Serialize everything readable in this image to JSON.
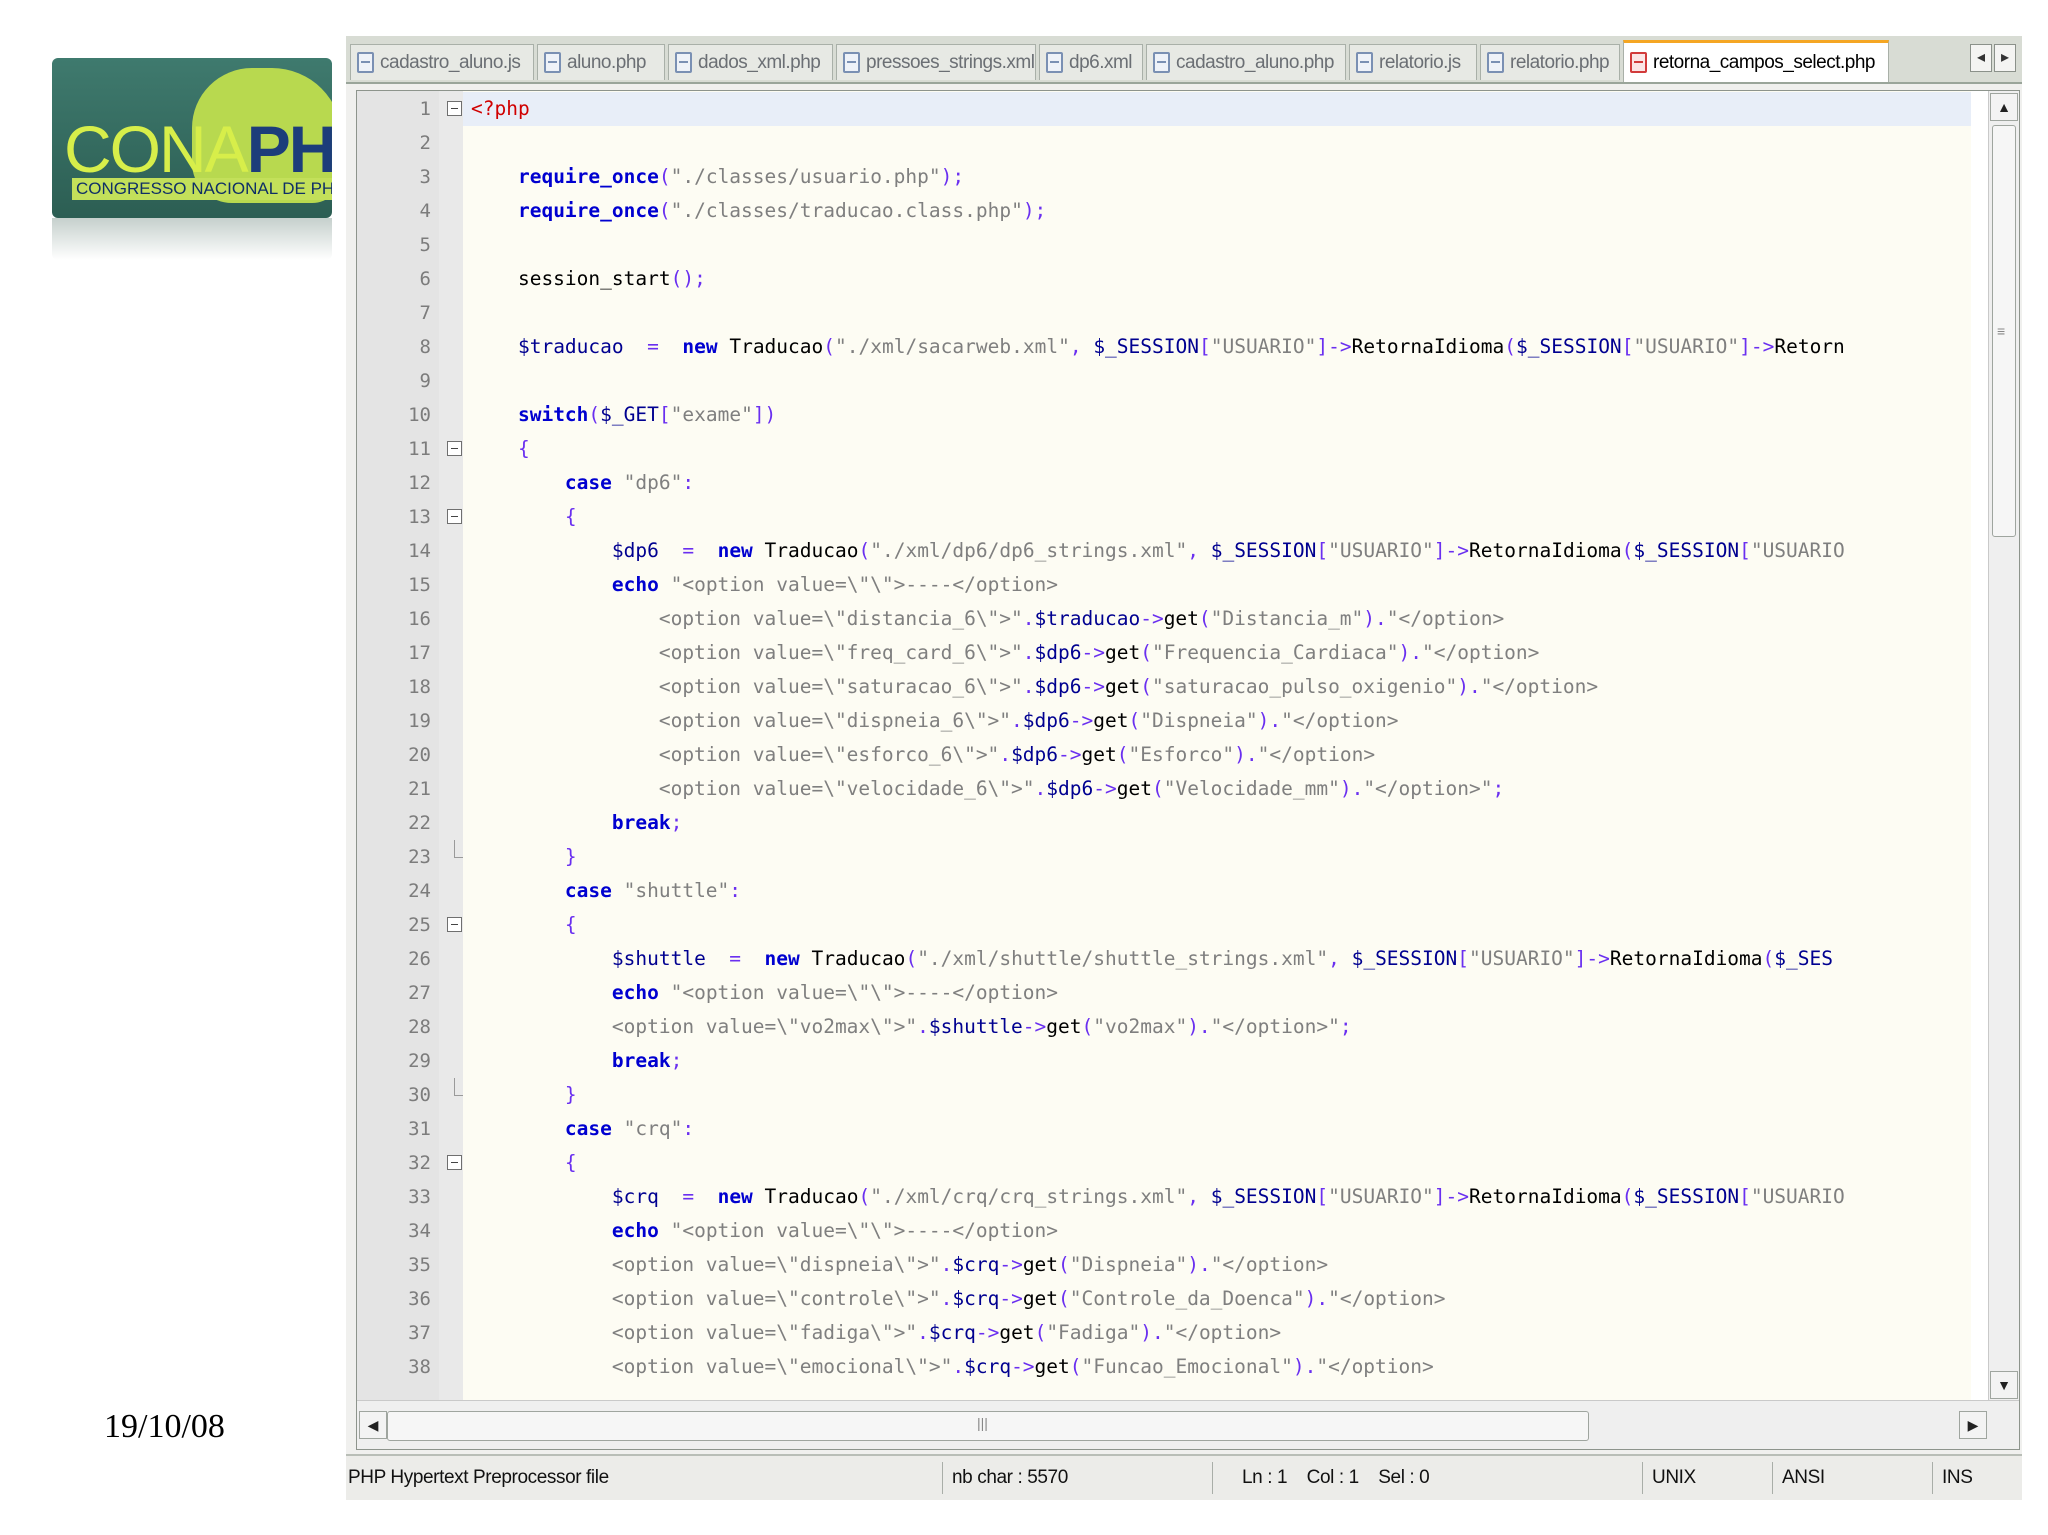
{
  "logo": {
    "main_left": "CONA",
    "main_right": "PHP",
    "sub": "CONGRESSO NACIONAL DE PHP"
  },
  "slide_date": "19/10/08",
  "tabs": [
    {
      "label": "cadastro_aluno.js",
      "active": false
    },
    {
      "label": "aluno.php",
      "active": false
    },
    {
      "label": "dados_xml.php",
      "active": false
    },
    {
      "label": "pressoes_strings.xml",
      "active": false
    },
    {
      "label": "dp6.xml",
      "active": false
    },
    {
      "label": "cadastro_aluno.php",
      "active": false
    },
    {
      "label": "relatorio.js",
      "active": false
    },
    {
      "label": "relatorio.php",
      "active": false
    },
    {
      "label": "retorna_campos_select.php",
      "active": true
    }
  ],
  "tab_nav": {
    "left": "◂",
    "right": "▸"
  },
  "scroll_glyphs": {
    "up": "▲",
    "down": "▼",
    "left": "◀",
    "right": "▶",
    "vgrip": "≡",
    "hgrip": "|||"
  },
  "lines": [
    {
      "n": "1",
      "fold": "open",
      "tokens": [
        [
          "php",
          "<?php"
        ]
      ]
    },
    {
      "n": "2",
      "tokens": []
    },
    {
      "n": "3",
      "tokens": [
        [
          "",
          "    "
        ],
        [
          "kw",
          "require_once"
        ],
        [
          "op",
          "("
        ],
        [
          "str",
          "\"./classes/usuario.php\""
        ],
        [
          "op",
          ");"
        ]
      ]
    },
    {
      "n": "4",
      "tokens": [
        [
          "",
          "    "
        ],
        [
          "kw",
          "require_once"
        ],
        [
          "op",
          "("
        ],
        [
          "str",
          "\"./classes/traducao.class.php\""
        ],
        [
          "op",
          ");"
        ]
      ]
    },
    {
      "n": "5",
      "tokens": []
    },
    {
      "n": "6",
      "tokens": [
        [
          "",
          "    session_start"
        ],
        [
          "op",
          "();"
        ]
      ]
    },
    {
      "n": "7",
      "tokens": []
    },
    {
      "n": "8",
      "tokens": [
        [
          "",
          "    "
        ],
        [
          "var",
          "$traducao"
        ],
        [
          "",
          "  "
        ],
        [
          "op",
          "="
        ],
        [
          "",
          "  "
        ],
        [
          "kw",
          "new"
        ],
        [
          "",
          " Traducao"
        ],
        [
          "op",
          "("
        ],
        [
          "str",
          "\"./xml/sacarweb.xml\""
        ],
        [
          "op",
          ","
        ],
        [
          "",
          ""
        ],
        [
          "var",
          " $_SESSION"
        ],
        [
          "op",
          "["
        ],
        [
          "str",
          "\"USUARIO\""
        ],
        [
          "op",
          "]->"
        ],
        [
          "",
          "RetornaIdioma"
        ],
        [
          "op",
          "("
        ],
        [
          "var",
          "$_SESSION"
        ],
        [
          "op",
          "["
        ],
        [
          "str",
          "\"USUARIO\""
        ],
        [
          "op",
          "]->"
        ],
        [
          "",
          "Retorn"
        ]
      ]
    },
    {
      "n": "9",
      "tokens": []
    },
    {
      "n": "10",
      "tokens": [
        [
          "",
          "    "
        ],
        [
          "kw",
          "switch"
        ],
        [
          "op",
          "("
        ],
        [
          "var",
          "$_GET"
        ],
        [
          "op",
          "["
        ],
        [
          "str",
          "\"exame\""
        ],
        [
          "op",
          "])"
        ]
      ]
    },
    {
      "n": "11",
      "fold": "open",
      "tokens": [
        [
          "",
          "    "
        ],
        [
          "op",
          "{"
        ]
      ]
    },
    {
      "n": "12",
      "tokens": [
        [
          "",
          "        "
        ],
        [
          "kw",
          "case"
        ],
        [
          "str",
          " \"dp6\""
        ],
        [
          "op",
          ":"
        ]
      ]
    },
    {
      "n": "13",
      "fold": "open",
      "tokens": [
        [
          "",
          "        "
        ],
        [
          "op",
          "{"
        ]
      ]
    },
    {
      "n": "14",
      "tokens": [
        [
          "",
          "            "
        ],
        [
          "var",
          "$dp6"
        ],
        [
          "",
          "  "
        ],
        [
          "op",
          "="
        ],
        [
          "",
          "  "
        ],
        [
          "kw",
          "new"
        ],
        [
          "",
          " Traducao"
        ],
        [
          "op",
          "("
        ],
        [
          "str",
          "\"./xml/dp6/dp6_strings.xml\""
        ],
        [
          "op",
          ","
        ],
        [
          "var",
          " $_SESSION"
        ],
        [
          "op",
          "["
        ],
        [
          "str",
          "\"USUARIO\""
        ],
        [
          "op",
          "]->"
        ],
        [
          "",
          "RetornaIdioma"
        ],
        [
          "op",
          "("
        ],
        [
          "var",
          "$_SESSION"
        ],
        [
          "op",
          "["
        ],
        [
          "str",
          "\"USUARIO"
        ]
      ]
    },
    {
      "n": "15",
      "tokens": [
        [
          "",
          "            "
        ],
        [
          "kw",
          "echo"
        ],
        [
          "str",
          " \"<option value=\\\"\\\">----</option>"
        ]
      ]
    },
    {
      "n": "16",
      "tokens": [
        [
          "str",
          "                <option value=\\\"distancia_6\\\">\""
        ],
        [
          "op",
          "."
        ],
        [
          "var",
          "$traducao"
        ],
        [
          "op",
          "->"
        ],
        [
          "",
          "get"
        ],
        [
          "op",
          "("
        ],
        [
          "str",
          "\"Distancia_m\""
        ],
        [
          "op",
          ")."
        ],
        [
          "str",
          "\"</option>"
        ]
      ]
    },
    {
      "n": "17",
      "tokens": [
        [
          "str",
          "                <option value=\\\"freq_card_6\\\">\""
        ],
        [
          "op",
          "."
        ],
        [
          "var",
          "$dp6"
        ],
        [
          "op",
          "->"
        ],
        [
          "",
          "get"
        ],
        [
          "op",
          "("
        ],
        [
          "str",
          "\"Frequencia_Cardiaca\""
        ],
        [
          "op",
          ")."
        ],
        [
          "str",
          "\"</option>"
        ]
      ]
    },
    {
      "n": "18",
      "tokens": [
        [
          "str",
          "                <option value=\\\"saturacao_6\\\">\""
        ],
        [
          "op",
          "."
        ],
        [
          "var",
          "$dp6"
        ],
        [
          "op",
          "->"
        ],
        [
          "",
          "get"
        ],
        [
          "op",
          "("
        ],
        [
          "str",
          "\"saturacao_pulso_oxigenio\""
        ],
        [
          "op",
          ")."
        ],
        [
          "str",
          "\"</option>"
        ]
      ]
    },
    {
      "n": "19",
      "tokens": [
        [
          "str",
          "                <option value=\\\"dispneia_6\\\">\""
        ],
        [
          "op",
          "."
        ],
        [
          "var",
          "$dp6"
        ],
        [
          "op",
          "->"
        ],
        [
          "",
          "get"
        ],
        [
          "op",
          "("
        ],
        [
          "str",
          "\"Dispneia\""
        ],
        [
          "op",
          ")."
        ],
        [
          "str",
          "\"</option>"
        ]
      ]
    },
    {
      "n": "20",
      "tokens": [
        [
          "str",
          "                <option value=\\\"esforco_6\\\">\""
        ],
        [
          "op",
          "."
        ],
        [
          "var",
          "$dp6"
        ],
        [
          "op",
          "->"
        ],
        [
          "",
          "get"
        ],
        [
          "op",
          "("
        ],
        [
          "str",
          "\"Esforco\""
        ],
        [
          "op",
          ")."
        ],
        [
          "str",
          "\"</option>"
        ]
      ]
    },
    {
      "n": "21",
      "tokens": [
        [
          "str",
          "                <option value=\\\"velocidade_6\\\">\""
        ],
        [
          "op",
          "."
        ],
        [
          "var",
          "$dp6"
        ],
        [
          "op",
          "->"
        ],
        [
          "",
          "get"
        ],
        [
          "op",
          "("
        ],
        [
          "str",
          "\"Velocidade_mm\""
        ],
        [
          "op",
          ")."
        ],
        [
          "str",
          "\"</option>\""
        ],
        [
          "op",
          ";"
        ]
      ]
    },
    {
      "n": "22",
      "tokens": [
        [
          "",
          "            "
        ],
        [
          "kw",
          "break"
        ],
        [
          "op",
          ";"
        ]
      ]
    },
    {
      "n": "23",
      "fold": "end",
      "tokens": [
        [
          "",
          "        "
        ],
        [
          "op",
          "}"
        ]
      ]
    },
    {
      "n": "24",
      "tokens": [
        [
          "",
          "        "
        ],
        [
          "kw",
          "case"
        ],
        [
          "str",
          " \"shuttle\""
        ],
        [
          "op",
          ":"
        ]
      ]
    },
    {
      "n": "25",
      "fold": "open",
      "tokens": [
        [
          "",
          "        "
        ],
        [
          "op",
          "{"
        ]
      ]
    },
    {
      "n": "26",
      "tokens": [
        [
          "",
          "            "
        ],
        [
          "var",
          "$shuttle"
        ],
        [
          "",
          "  "
        ],
        [
          "op",
          "="
        ],
        [
          "",
          "  "
        ],
        [
          "kw",
          "new"
        ],
        [
          "",
          " Traducao"
        ],
        [
          "op",
          "("
        ],
        [
          "str",
          "\"./xml/shuttle/shuttle_strings.xml\""
        ],
        [
          "op",
          ","
        ],
        [
          "var",
          " $_SESSION"
        ],
        [
          "op",
          "["
        ],
        [
          "str",
          "\"USUARIO\""
        ],
        [
          "op",
          "]->"
        ],
        [
          "",
          "RetornaIdioma"
        ],
        [
          "op",
          "("
        ],
        [
          "var",
          "$_SES"
        ]
      ]
    },
    {
      "n": "27",
      "tokens": [
        [
          "",
          "            "
        ],
        [
          "kw",
          "echo"
        ],
        [
          "str",
          " \"<option value=\\\"\\\">----</option>"
        ]
      ]
    },
    {
      "n": "28",
      "tokens": [
        [
          "str",
          "            <option value=\\\"vo2max\\\">\""
        ],
        [
          "op",
          "."
        ],
        [
          "var",
          "$shuttle"
        ],
        [
          "op",
          "->"
        ],
        [
          "",
          "get"
        ],
        [
          "op",
          "("
        ],
        [
          "str",
          "\"vo2max\""
        ],
        [
          "op",
          ")."
        ],
        [
          "str",
          "\"</option>\""
        ],
        [
          "op",
          ";"
        ]
      ]
    },
    {
      "n": "29",
      "tokens": [
        [
          "",
          "            "
        ],
        [
          "kw",
          "break"
        ],
        [
          "op",
          ";"
        ]
      ]
    },
    {
      "n": "30",
      "fold": "end",
      "tokens": [
        [
          "",
          "        "
        ],
        [
          "op",
          "}"
        ]
      ]
    },
    {
      "n": "31",
      "tokens": [
        [
          "",
          "        "
        ],
        [
          "kw",
          "case"
        ],
        [
          "str",
          " \"crq\""
        ],
        [
          "op",
          ":"
        ]
      ]
    },
    {
      "n": "32",
      "fold": "open",
      "tokens": [
        [
          "",
          "        "
        ],
        [
          "op",
          "{"
        ]
      ]
    },
    {
      "n": "33",
      "tokens": [
        [
          "",
          "            "
        ],
        [
          "var",
          "$crq"
        ],
        [
          "",
          "  "
        ],
        [
          "op",
          "="
        ],
        [
          "",
          "  "
        ],
        [
          "kw",
          "new"
        ],
        [
          "",
          " Traducao"
        ],
        [
          "op",
          "("
        ],
        [
          "str",
          "\"./xml/crq/crq_strings.xml\""
        ],
        [
          "op",
          ","
        ],
        [
          "var",
          " $_SESSION"
        ],
        [
          "op",
          "["
        ],
        [
          "str",
          "\"USUARIO\""
        ],
        [
          "op",
          "]->"
        ],
        [
          "",
          "RetornaIdioma"
        ],
        [
          "op",
          "("
        ],
        [
          "var",
          "$_SESSION"
        ],
        [
          "op",
          "["
        ],
        [
          "str",
          "\"USUARIO"
        ]
      ]
    },
    {
      "n": "34",
      "tokens": [
        [
          "",
          "            "
        ],
        [
          "kw",
          "echo"
        ],
        [
          "str",
          " \"<option value=\\\"\\\">----</option>"
        ]
      ]
    },
    {
      "n": "35",
      "tokens": [
        [
          "str",
          "            <option value=\\\"dispneia\\\">\""
        ],
        [
          "op",
          "."
        ],
        [
          "var",
          "$crq"
        ],
        [
          "op",
          "->"
        ],
        [
          "",
          "get"
        ],
        [
          "op",
          "("
        ],
        [
          "str",
          "\"Dispneia\""
        ],
        [
          "op",
          ")."
        ],
        [
          "str",
          "\"</option>"
        ]
      ]
    },
    {
      "n": "36",
      "tokens": [
        [
          "str",
          "            <option value=\\\"controle\\\">\""
        ],
        [
          "op",
          "."
        ],
        [
          "var",
          "$crq"
        ],
        [
          "op",
          "->"
        ],
        [
          "",
          "get"
        ],
        [
          "op",
          "("
        ],
        [
          "str",
          "\"Controle_da_Doenca\""
        ],
        [
          "op",
          ")."
        ],
        [
          "str",
          "\"</option>"
        ]
      ]
    },
    {
      "n": "37",
      "tokens": [
        [
          "str",
          "            <option value=\\\"fadiga\\\">\""
        ],
        [
          "op",
          "."
        ],
        [
          "var",
          "$crq"
        ],
        [
          "op",
          "->"
        ],
        [
          "",
          "get"
        ],
        [
          "op",
          "("
        ],
        [
          "str",
          "\"Fadiga\""
        ],
        [
          "op",
          ")."
        ],
        [
          "str",
          "\"</option>"
        ]
      ]
    },
    {
      "n": "38",
      "tokens": [
        [
          "str",
          "            <option value=\\\"emocional\\\">\""
        ],
        [
          "op",
          "."
        ],
        [
          "var",
          "$crq"
        ],
        [
          "op",
          "->"
        ],
        [
          "",
          "get"
        ],
        [
          "op",
          "("
        ],
        [
          "str",
          "\"Funcao_Emocional\""
        ],
        [
          "op",
          ")."
        ],
        [
          "str",
          "\"</option>"
        ]
      ]
    }
  ],
  "status": {
    "file_type": "PHP Hypertext Preprocessor file",
    "nb_char": "nb char : 5570",
    "position": "Ln : 1    Col : 1    Sel : 0",
    "eol": "UNIX",
    "encoding": "ANSI",
    "mode": "INS"
  },
  "colors": {
    "accent_tab": "#f5a623",
    "keyword": "#0000d0",
    "string": "#7f7f7f",
    "php_tag": "#d00000",
    "variable": "#000090"
  }
}
